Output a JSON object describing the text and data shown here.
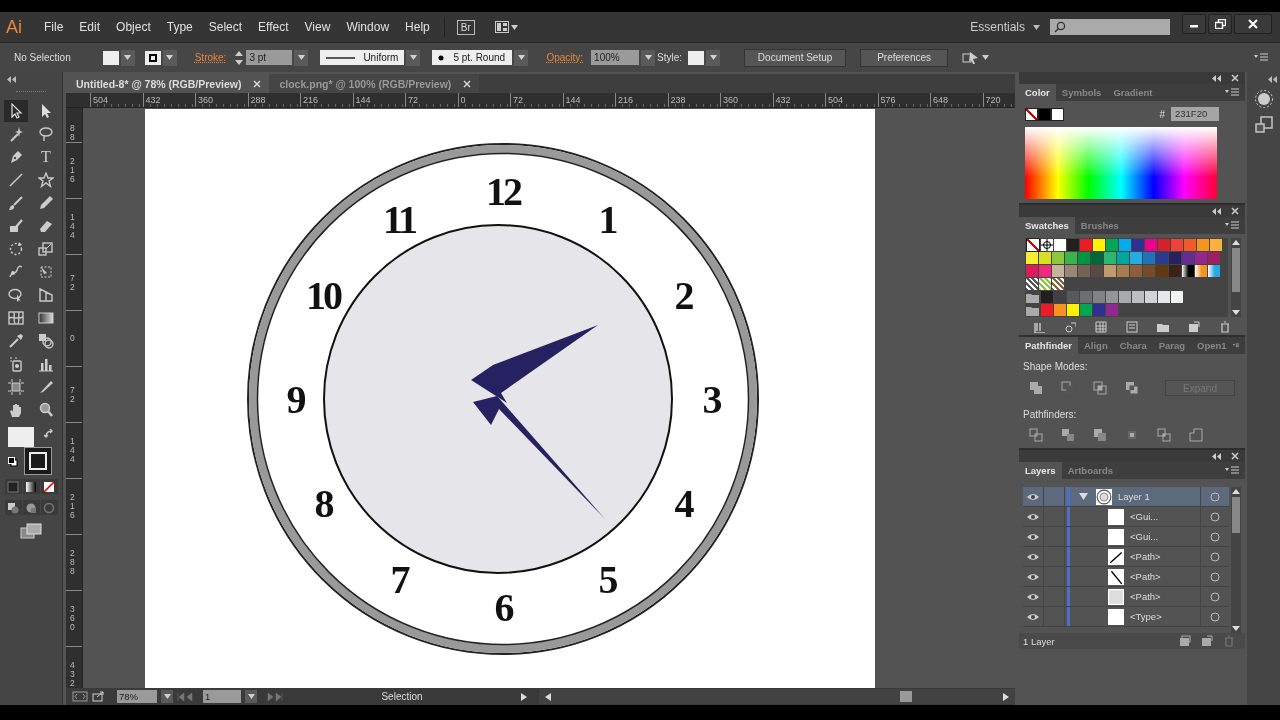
{
  "app": {
    "logo": "Ai",
    "bridge": "Br",
    "workspace": "Essentials"
  },
  "menu": [
    "File",
    "Edit",
    "Object",
    "Type",
    "Select",
    "Effect",
    "View",
    "Window",
    "Help"
  ],
  "control_bar": {
    "selection": "No Selection",
    "stroke_label": "Stroke:",
    "stroke_weight": "3 pt",
    "profile": "Uniform",
    "brush": "5 pt. Round",
    "opacity_label": "Opacity:",
    "opacity": "100%",
    "style_label": "Style:",
    "buttons": [
      "Document Setup",
      "Preferences"
    ]
  },
  "doc_tabs": [
    {
      "title": "Untitled-8* @ 78% (RGB/Preview)",
      "selected": true
    },
    {
      "title": "clock.png* @ 100% (RGB/Preview)",
      "selected": false
    }
  ],
  "ruler_h": [
    "504",
    "432",
    "360",
    "288",
    "216",
    "144",
    "72",
    "0",
    "72",
    "144",
    "216",
    "238",
    "360",
    "432",
    "504",
    "576",
    "648",
    "720"
  ],
  "ruler_v": [
    "88",
    "216",
    "144",
    "72",
    "0",
    "72",
    "144",
    "216",
    "288",
    "360",
    "432"
  ],
  "tools": [
    {
      "kind": "selection",
      "selected": true
    },
    {
      "kind": "direct-selection",
      "selected": false
    },
    {
      "kind": "magic-wand",
      "selected": false
    },
    {
      "kind": "lasso",
      "selected": false
    },
    {
      "kind": "pen",
      "selected": false
    },
    {
      "kind": "type",
      "label": "T",
      "selected": false
    },
    {
      "kind": "line",
      "selected": false
    },
    {
      "kind": "star",
      "selected": false
    },
    {
      "kind": "paintbrush",
      "selected": false
    },
    {
      "kind": "pencil",
      "selected": false
    },
    {
      "kind": "blob-brush",
      "selected": false
    },
    {
      "kind": "eraser",
      "selected": false
    },
    {
      "kind": "rotate",
      "selected": false
    },
    {
      "kind": "scale",
      "selected": false
    },
    {
      "kind": "warp",
      "selected": false
    },
    {
      "kind": "free-transform",
      "selected": false
    },
    {
      "kind": "shape-builder",
      "selected": false
    },
    {
      "kind": "perspective",
      "selected": false
    },
    {
      "kind": "mesh",
      "selected": false
    },
    {
      "kind": "gradient",
      "selected": false
    },
    {
      "kind": "eyedropper",
      "selected": false
    },
    {
      "kind": "blend",
      "selected": false
    },
    {
      "kind": "sprayer",
      "selected": false
    },
    {
      "kind": "graph",
      "selected": false
    },
    {
      "kind": "artboard",
      "selected": false
    },
    {
      "kind": "slice",
      "selected": false
    },
    {
      "kind": "hand",
      "selected": false
    },
    {
      "kind": "zoom",
      "selected": false
    }
  ],
  "clock": {
    "numerals": [
      "12",
      "1",
      "2",
      "3",
      "4",
      "5",
      "6",
      "7",
      "8",
      "9",
      "10",
      "11"
    ]
  },
  "color_panel": {
    "tabs": [
      {
        "label": "Color",
        "selected": true
      },
      {
        "label": "Symbols",
        "selected": false
      },
      {
        "label": "Gradient",
        "selected": false
      }
    ],
    "hex_label": "#",
    "hex": "231F20"
  },
  "swatches_panel": {
    "tabs": [
      {
        "label": "Swatches",
        "selected": true
      },
      {
        "label": "Brushes",
        "selected": false
      }
    ],
    "rows": [
      {
        "folder": false,
        "items": [
          {
            "kind": "none"
          },
          {
            "kind": "registration"
          },
          {
            "kind": "color",
            "color": "#ffffff"
          },
          {
            "kind": "color",
            "color": "#231f20"
          },
          {
            "kind": "color",
            "color": "#ed1c24"
          },
          {
            "kind": "color",
            "color": "#fff200"
          },
          {
            "kind": "color",
            "color": "#00a651"
          },
          {
            "kind": "color",
            "color": "#00aeef"
          },
          {
            "kind": "color",
            "color": "#2e3192"
          },
          {
            "kind": "color",
            "color": "#ec008c"
          },
          {
            "kind": "color",
            "color": "#d2232a"
          },
          {
            "kind": "color",
            "color": "#ef4136"
          },
          {
            "kind": "color",
            "color": "#f15a29"
          },
          {
            "kind": "color",
            "color": "#f7941d"
          },
          {
            "kind": "color",
            "color": "#fbb040"
          }
        ]
      },
      {
        "folder": false,
        "items": [
          {
            "kind": "color",
            "color": "#f9ed32"
          },
          {
            "kind": "color",
            "color": "#d7df23"
          },
          {
            "kind": "color",
            "color": "#8dc63f"
          },
          {
            "kind": "color",
            "color": "#39b54a"
          },
          {
            "kind": "color",
            "color": "#009444"
          },
          {
            "kind": "color",
            "color": "#006838"
          },
          {
            "kind": "color",
            "color": "#2bb673"
          },
          {
            "kind": "color",
            "color": "#00a79d"
          },
          {
            "kind": "color",
            "color": "#27aae1"
          },
          {
            "kind": "color",
            "color": "#1c75bc"
          },
          {
            "kind": "color",
            "color": "#2b3990"
          },
          {
            "kind": "color",
            "color": "#262262"
          },
          {
            "kind": "color",
            "color": "#662d91"
          },
          {
            "kind": "color",
            "color": "#92278f"
          },
          {
            "kind": "color",
            "color": "#9e1f63"
          }
        ]
      },
      {
        "folder": false,
        "items": [
          {
            "kind": "color",
            "color": "#da1c5c"
          },
          {
            "kind": "color",
            "color": "#ee2a7b"
          },
          {
            "kind": "color",
            "color": "#c2b59b"
          },
          {
            "kind": "color",
            "color": "#998675"
          },
          {
            "kind": "color",
            "color": "#736357"
          },
          {
            "kind": "color",
            "color": "#594a42"
          },
          {
            "kind": "color",
            "color": "#c49a6c"
          },
          {
            "kind": "color",
            "color": "#a97c50"
          },
          {
            "kind": "color",
            "color": "#8b5e3c"
          },
          {
            "kind": "color",
            "color": "#754c29"
          },
          {
            "kind": "color",
            "color": "#603913"
          },
          {
            "kind": "color",
            "color": "#3c2415"
          },
          {
            "kind": "gradient",
            "color": "#000000"
          },
          {
            "kind": "gradient",
            "color": "#f7941d"
          },
          {
            "kind": "gradient",
            "color": "#27aae1"
          }
        ]
      },
      {
        "folder": false,
        "items": [
          {
            "kind": "pattern",
            "color": "#555555"
          },
          {
            "kind": "pattern",
            "color": "#8dc63f"
          },
          {
            "kind": "pattern",
            "color": "#8b5e3c"
          }
        ]
      },
      {
        "folder": true,
        "items": [
          {
            "kind": "color",
            "color": "#231f20"
          },
          {
            "kind": "color",
            "color": "#414042"
          },
          {
            "kind": "color",
            "color": "#58595b"
          },
          {
            "kind": "color",
            "color": "#6d6e71"
          },
          {
            "kind": "color",
            "color": "#808285"
          },
          {
            "kind": "color",
            "color": "#939598"
          },
          {
            "kind": "color",
            "color": "#a7a9ac"
          },
          {
            "kind": "color",
            "color": "#bcbec0"
          },
          {
            "kind": "color",
            "color": "#d1d3d4"
          },
          {
            "kind": "color",
            "color": "#e6e7e8"
          },
          {
            "kind": "color",
            "color": "#f1f2f2"
          }
        ]
      },
      {
        "folder": true,
        "items": [
          {
            "kind": "color",
            "color": "#ed1c24"
          },
          {
            "kind": "color",
            "color": "#f7941d"
          },
          {
            "kind": "color",
            "color": "#fff200"
          },
          {
            "kind": "color",
            "color": "#00a651"
          },
          {
            "kind": "color",
            "color": "#2e3192"
          },
          {
            "kind": "color",
            "color": "#92278f"
          }
        ]
      }
    ]
  },
  "pathfinder_panel": {
    "tabs": [
      {
        "label": "Pathfinder",
        "selected": true
      },
      {
        "label": "Align",
        "selected": false
      },
      {
        "label": "Chara",
        "selected": false
      },
      {
        "label": "Parag",
        "selected": false
      },
      {
        "label": "Open1",
        "selected": false
      }
    ],
    "shape_modes_label": "Shape Modes:",
    "expand": {
      "label": "Expand",
      "disabled": true
    },
    "pathfinders_label": "Pathfinders:"
  },
  "layers_panel": {
    "tabs": [
      {
        "label": "Layers",
        "selected": true
      },
      {
        "label": "Artboards",
        "selected": false
      }
    ],
    "layers": [
      {
        "name": "Layer 1",
        "kind": "clock",
        "expanded": true,
        "selected": true,
        "children": [
          {
            "name": "<Gui...",
            "kind": "blank",
            "selected": false
          },
          {
            "name": "<Gui...",
            "kind": "blank",
            "selected": false
          },
          {
            "name": "<Path>",
            "kind": "rising-line",
            "selected": false
          },
          {
            "name": "<Path>",
            "kind": "falling-line",
            "selected": false
          },
          {
            "name": "<Path>",
            "kind": "gray",
            "selected": false
          },
          {
            "name": "<Type>",
            "kind": "blank",
            "selected": false
          }
        ]
      }
    ],
    "count": "1 Layer"
  },
  "status_bar": {
    "zoom": "78%",
    "artboard": "1",
    "tool": "Selection"
  }
}
